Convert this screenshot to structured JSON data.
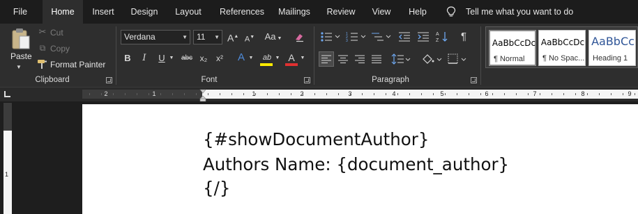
{
  "menu": {
    "tabs": [
      {
        "label": "File",
        "active": false
      },
      {
        "label": "Home",
        "active": true
      },
      {
        "label": "Insert",
        "active": false
      },
      {
        "label": "Design",
        "active": false
      },
      {
        "label": "Layout",
        "active": false
      },
      {
        "label": "References",
        "active": false
      },
      {
        "label": "Mailings",
        "active": false
      },
      {
        "label": "Review",
        "active": false
      },
      {
        "label": "View",
        "active": false
      },
      {
        "label": "Help",
        "active": false
      }
    ],
    "tell_me": "Tell me what you want to do"
  },
  "ribbon": {
    "clipboard": {
      "label": "Clipboard",
      "paste": "Paste",
      "cut": "Cut",
      "copy": "Copy",
      "format_painter": "Format Painter"
    },
    "font": {
      "label": "Font",
      "font_name": "Verdana",
      "font_size": "11",
      "grow": "A",
      "shrink": "A",
      "change_case": "Aa",
      "bold": "B",
      "italic": "I",
      "underline": "U",
      "strike": "abc",
      "subscript": "x₂",
      "superscript": "x²",
      "effects": "A",
      "highlight": "ab",
      "font_color": "A",
      "highlight_color": "#ffeb00",
      "font_color_value": "#e03030"
    },
    "paragraph": {
      "label": "Paragraph",
      "pilcrow": "¶"
    },
    "styles": {
      "items": [
        {
          "sample": "AaBbCcDc",
          "name": "¶ Normal"
        },
        {
          "sample": "AaBbCcDc",
          "name": "¶ No Spac..."
        },
        {
          "sample": "AaBbCc",
          "name": "Heading 1"
        }
      ],
      "heading_color": "#2f5597"
    }
  },
  "ruler": {
    "numbers_left": [
      "2",
      "1"
    ],
    "numbers_right": [
      "1",
      "2",
      "3",
      "4",
      "5",
      "6",
      "7",
      "8",
      "9"
    ],
    "vertical_number": "1"
  },
  "document": {
    "lines": [
      "{#showDocumentAuthor}",
      "Authors Name: {document_author}",
      "{/}"
    ]
  }
}
